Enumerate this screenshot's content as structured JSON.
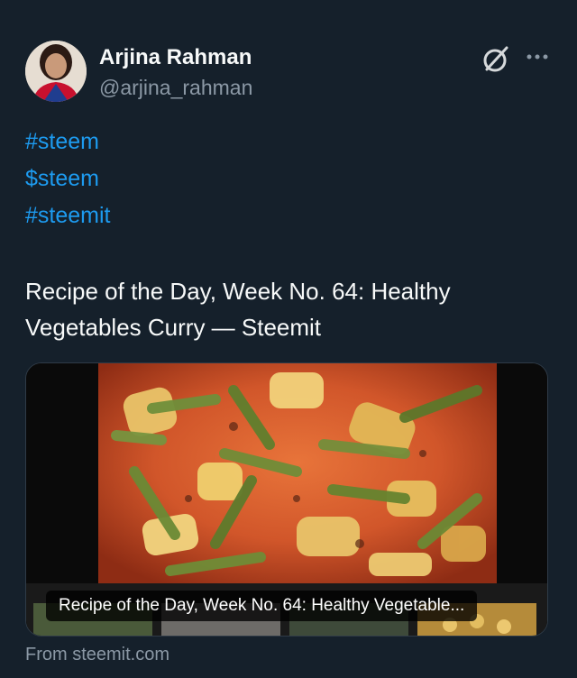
{
  "author": {
    "name": "Arjina Rahman",
    "handle": "@arjina_rahman"
  },
  "header_icons": [
    "grok-icon",
    "more-icon"
  ],
  "hashtags": [
    "#steem",
    "$steem",
    "#steemit"
  ],
  "post": {
    "title_line_1": "Recipe of the Day, Week No. 64: Healthy",
    "title_line_2": "Vegetables Curry — Steemit"
  },
  "link_card": {
    "caption": "Recipe of the Day, Week No. 64: Healthy Vegetable...",
    "source": "From steemit.com"
  },
  "colors": {
    "background": "#15202b",
    "link": "#1d9bf0",
    "secondary_text": "#8b98a5"
  }
}
